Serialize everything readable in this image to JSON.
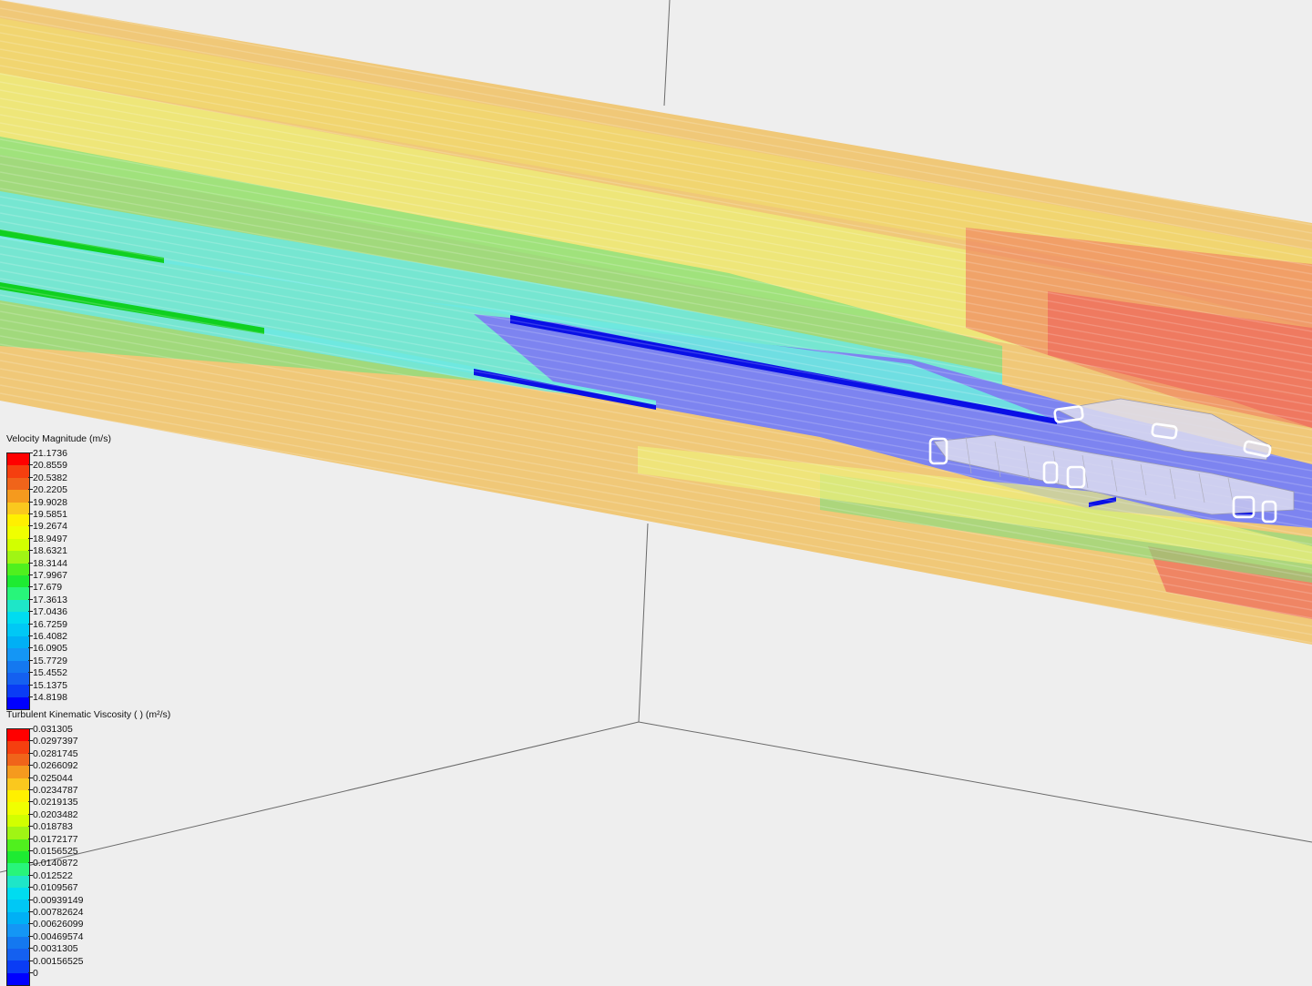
{
  "scene": {
    "background": "#eeeeee",
    "axis_color": "#6a6a6a"
  },
  "legends": [
    {
      "id": "velocity",
      "title": "Velocity Magnitude (m/s)",
      "labels": [
        "21.1736",
        "20.8559",
        "20.5382",
        "20.2205",
        "19.9028",
        "19.5851",
        "19.2674",
        "18.9497",
        "18.6321",
        "18.3144",
        "17.9967",
        "17.679",
        "17.3613",
        "17.0436",
        "16.7259",
        "16.4082",
        "16.0905",
        "15.7729",
        "15.4552",
        "15.1375",
        "14.8198"
      ],
      "colors": [
        "#ff0000",
        "#f53f0f",
        "#f0641a",
        "#f59a1e",
        "#fac81e",
        "#fff000",
        "#f0ff00",
        "#d2ff00",
        "#a0f514",
        "#50f01e",
        "#1eeb32",
        "#28f57a",
        "#1ee6c8",
        "#00dcf0",
        "#00c8f5",
        "#00b0f5",
        "#1496f5",
        "#1478f0",
        "#1460f0",
        "#0a3cf5",
        "#0000ff"
      ]
    },
    {
      "id": "turbulent",
      "title": "Turbulent Kinematic Viscosity (       ) (m²/s)",
      "labels": [
        "0.031305",
        "0.0297397",
        "0.0281745",
        "0.0266092",
        "0.025044",
        "0.0234787",
        "0.0219135",
        "0.0203482",
        "0.018783",
        "0.0172177",
        "0.0156525",
        "0.0140872",
        "0.012522",
        "0.0109567",
        "0.00939149",
        "0.00782624",
        "0.00626099",
        "0.00469574",
        "0.0031305",
        "0.00156525",
        "0"
      ],
      "colors": [
        "#ff0000",
        "#f53f0f",
        "#f0641a",
        "#f59a1e",
        "#fac81e",
        "#fff000",
        "#f0ff00",
        "#d2ff00",
        "#a0f514",
        "#50f01e",
        "#1eeb32",
        "#28f57a",
        "#1ee6c8",
        "#00dcf0",
        "#00c8f5",
        "#00b0f5",
        "#1496f5",
        "#1478f0",
        "#1460f0",
        "#0a3cf5",
        "#0000ff"
      ]
    }
  ],
  "flow_colors": {
    "free_stream": "#f0c878",
    "high": "#f08c64",
    "peak": "#ef6f5e",
    "mid": "#f2e06a",
    "yellow": "#eef07a",
    "green": "#7fe07e",
    "cyan": "#6ee8e0",
    "wake": "#7d84f0",
    "core": "#0a10e6",
    "strand": "#10d020"
  },
  "model": {
    "body_color": "#dcdcf0",
    "outline_color": "#ffffff"
  }
}
